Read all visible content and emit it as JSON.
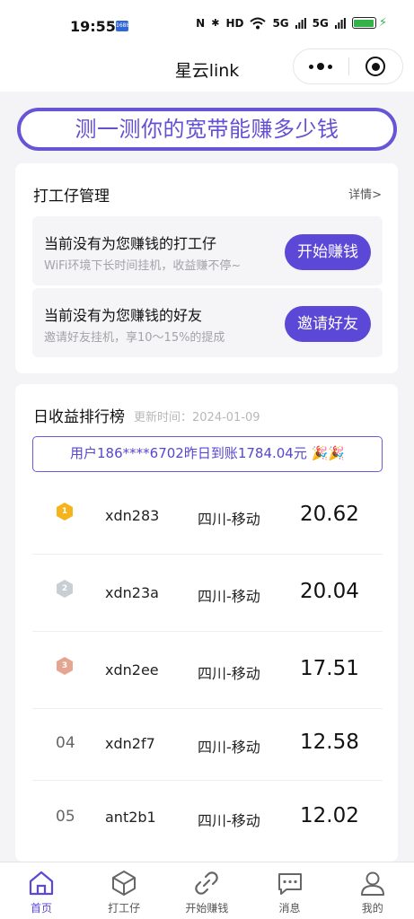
{
  "status_bar": {
    "time": "19:55",
    "badge": "1688",
    "nfc": "N",
    "bluetooth": "✱",
    "hd": "HD",
    "wifi": "wifi-icon",
    "signal1": "5G",
    "signal2": "5G",
    "battery_color": "#33b24a"
  },
  "nav": {
    "title": "星云link"
  },
  "banner": {
    "text": "测一测你的宽带能赚多少钱"
  },
  "worker_card": {
    "title": "打工仔管理",
    "link": "详情>",
    "tasks": [
      {
        "title": "当前没有为您赚钱的打工仔",
        "subtitle": "WiFi环境下长时间挂机，收益赚不停~",
        "button": "开始赚钱"
      },
      {
        "title": "当前没有为您赚钱的好友",
        "subtitle": "邀请好友挂机，享10～15%的提成",
        "button": "邀请好友"
      }
    ]
  },
  "ranking": {
    "title": "日收益排行榜",
    "updated": "更新时间：2024-01-09",
    "notice": "用户186****6702昨日到账1784.04元 🎉🎉",
    "rows": [
      {
        "rank": "1",
        "name": "xdn283",
        "region": "四川-移动",
        "value": "20.62"
      },
      {
        "rank": "2",
        "name": "xdn23a",
        "region": "四川-移动",
        "value": "20.04"
      },
      {
        "rank": "3",
        "name": "xdn2ee",
        "region": "四川-移动",
        "value": "17.51"
      },
      {
        "rank": "04",
        "name": "xdn2f7",
        "region": "四川-移动",
        "value": "12.58"
      },
      {
        "rank": "05",
        "name": "ant2b1",
        "region": "四川-移动",
        "value": "12.02"
      }
    ]
  },
  "tabbar": {
    "accent": "#5b48d7",
    "items": [
      {
        "label": "首页",
        "icon": "home-icon"
      },
      {
        "label": "打工仔",
        "icon": "cube-icon"
      },
      {
        "label": "开始赚钱",
        "icon": "link-icon"
      },
      {
        "label": "消息",
        "icon": "message-icon"
      },
      {
        "label": "我的",
        "icon": "user-icon"
      }
    ]
  }
}
